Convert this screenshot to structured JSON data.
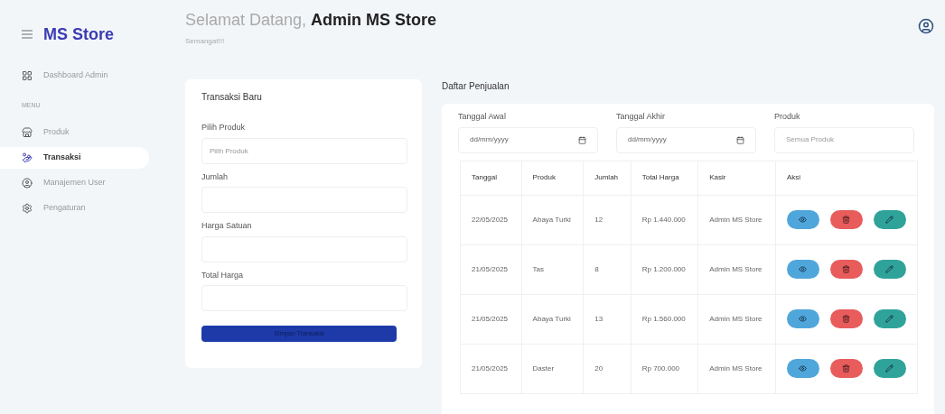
{
  "sidebar": {
    "brand": "MS Store",
    "items": [
      {
        "kind": "link",
        "label": "Dashboard Admin",
        "selected": false
      },
      {
        "kind": "heading",
        "label": "MENU"
      },
      {
        "kind": "link",
        "label": "Produk",
        "selected": false
      },
      {
        "kind": "link",
        "label": "Transaksi",
        "selected": true
      },
      {
        "kind": "link",
        "label": "Manajemen User",
        "selected": false
      },
      {
        "kind": "link",
        "label": "Pengaturan",
        "selected": false
      }
    ]
  },
  "header": {
    "greeting": "Selamat Datang,",
    "name": "Admin MS Store",
    "subtitle": "Semangat!!!"
  },
  "new_transaction": {
    "title": "Transaksi Baru",
    "fields": [
      {
        "label": "Pilih Produk",
        "placeholder": "Pilih Produk"
      },
      {
        "label": "Jumlah"
      },
      {
        "label": "Harga Satuan"
      },
      {
        "label": "Total Harga"
      }
    ],
    "submit": "Simpan Transaksi"
  },
  "sales": {
    "title": "Daftar Penjualan",
    "filters": [
      {
        "kind": "date",
        "label": "Tanggal Awal",
        "placeholder": "dd/mm/yyyy"
      },
      {
        "kind": "date",
        "label": "Tanggal Akhir",
        "placeholder": "dd/mm/yyyy"
      },
      {
        "kind": "select",
        "label": "Produk",
        "placeholder": "Semua Produk"
      }
    ],
    "table": {
      "columns": [
        "Tanggal",
        "Produk",
        "Jumlah",
        "Total Harga",
        "Kasir",
        "Aksi"
      ],
      "rows": [
        [
          "22/05/2025",
          "Abaya Turki",
          "12",
          "Rp 1.440.000",
          "Admin MS Store"
        ],
        [
          "21/05/2025",
          "Tas",
          "8",
          "Rp 1.200.000",
          "Admin MS Store"
        ],
        [
          "21/05/2025",
          "Abaya Turki",
          "13",
          "Rp 1.560.000",
          "Admin MS Store"
        ],
        [
          "21/05/2025",
          "Daster",
          "20",
          "Rp 700.000",
          "Admin MS Store"
        ]
      ]
    }
  }
}
